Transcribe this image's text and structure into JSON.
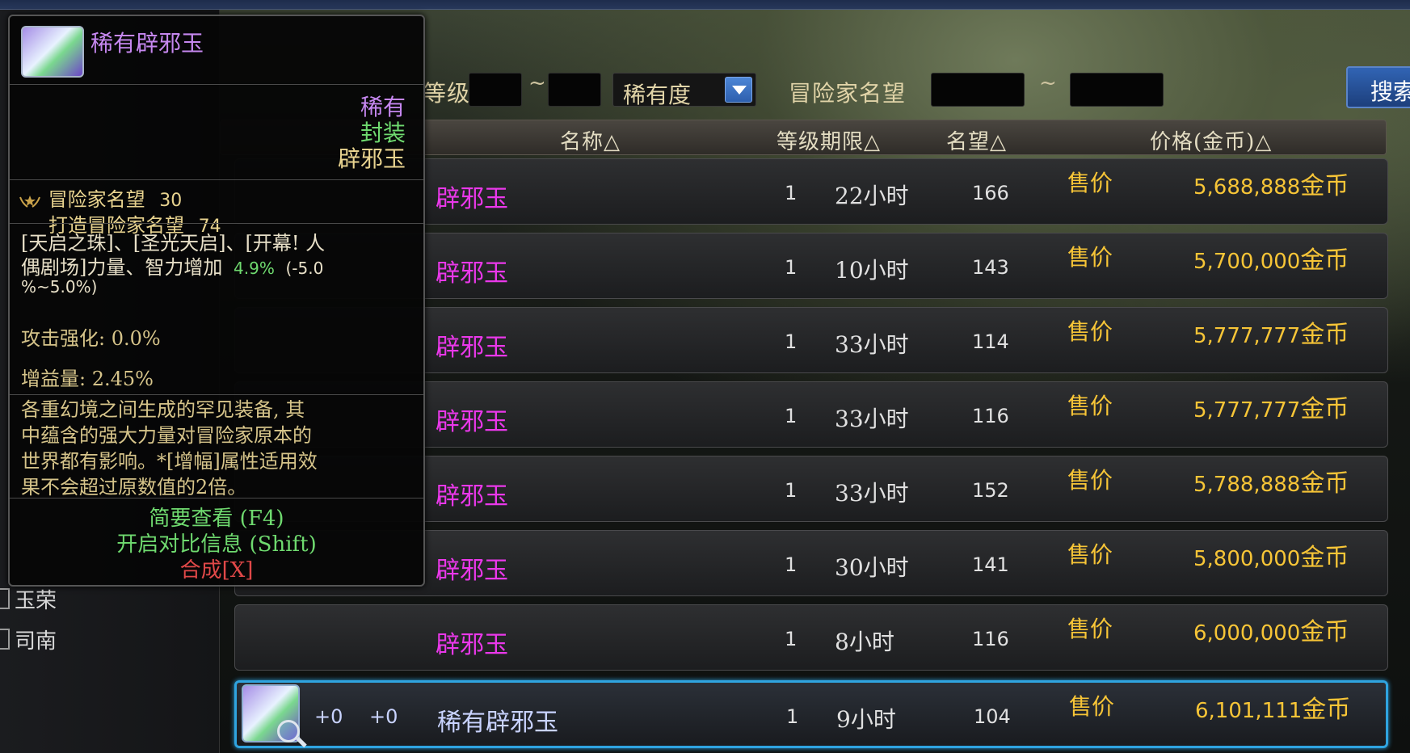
{
  "filters": {
    "level_label": "等级",
    "tilde": "~",
    "rarity_select": "稀有度",
    "fame_label": "冒险家名望",
    "search_button": "搜索"
  },
  "table": {
    "headers": {
      "name": "名称△",
      "level_limit": "等级期限△",
      "fame": "名望△",
      "price": "价格(金币)△"
    },
    "rows": [
      {
        "name": "辟邪玉",
        "level": "1",
        "duration": "22小时",
        "fame": "166",
        "sell_label": "售价",
        "price": "5,688,888",
        "unit": "金币"
      },
      {
        "name": "辟邪玉",
        "level": "1",
        "duration": "10小时",
        "fame": "143",
        "sell_label": "售价",
        "price": "5,700,000",
        "unit": "金币"
      },
      {
        "name": "辟邪玉",
        "level": "1",
        "duration": "33小时",
        "fame": "114",
        "sell_label": "售价",
        "price": "5,777,777",
        "unit": "金币"
      },
      {
        "name": "辟邪玉",
        "level": "1",
        "duration": "33小时",
        "fame": "116",
        "sell_label": "售价",
        "price": "5,777,777",
        "unit": "金币"
      },
      {
        "name": "辟邪玉",
        "level": "1",
        "duration": "33小时",
        "fame": "152",
        "sell_label": "售价",
        "price": "5,788,888",
        "unit": "金币"
      },
      {
        "name": "辟邪玉",
        "level": "1",
        "duration": "30小时",
        "fame": "141",
        "sell_label": "售价",
        "price": "5,800,000",
        "unit": "金币"
      },
      {
        "name": "辟邪玉",
        "level": "1",
        "duration": "8小时",
        "fame": "116",
        "sell_label": "售价",
        "price": "6,000,000",
        "unit": "金币"
      }
    ],
    "selected_row": {
      "plus1": "+0",
      "plus2": "+0",
      "name": "稀有辟邪玉",
      "level": "1",
      "duration": "9小时",
      "fame": "104",
      "sell_label": "售价",
      "price": "6,101,111",
      "unit": "金币"
    }
  },
  "sidebar": {
    "items": [
      "玉荣",
      "司南"
    ]
  },
  "tooltip": {
    "title": "稀有辟邪玉",
    "rarity": "稀有",
    "sealed": "封装",
    "type": "辟邪玉",
    "fame_line": "冒险家名望",
    "fame_value": "30",
    "craft_fame_line": "打造冒险家名望",
    "craft_fame_value": "74",
    "effect_line1": "[天启之珠]、[圣光天启]、[开幕! 人",
    "effect_line2_prefix": "偶剧场]力量、智力增加",
    "effect_value": "4.9%",
    "effect_range_a": "(-5.0",
    "effect_line3": "%~5.0%)",
    "attack_line": "攻击强化: 0.0%",
    "buff_line": "增益量: 2.45%",
    "desc_lines": [
      "各重幻境之间生成的罕见装备, 其",
      "中蕴含的强大力量对冒险家原本的",
      "世界都有影响。*[增幅]属性适用效",
      "果不会超过原数值的2倍。"
    ],
    "brief_view": "简要查看 (F4)",
    "compare_info": "开启对比信息 (Shift)",
    "synthesize": "合成[X]"
  },
  "colors": {
    "rare_purple": "#c587ef",
    "name_magenta": "#ea38ea",
    "gold": "#f7c537",
    "green": "#6fda6f",
    "red": "#e04848",
    "select_blue": "#2fa4e0"
  }
}
